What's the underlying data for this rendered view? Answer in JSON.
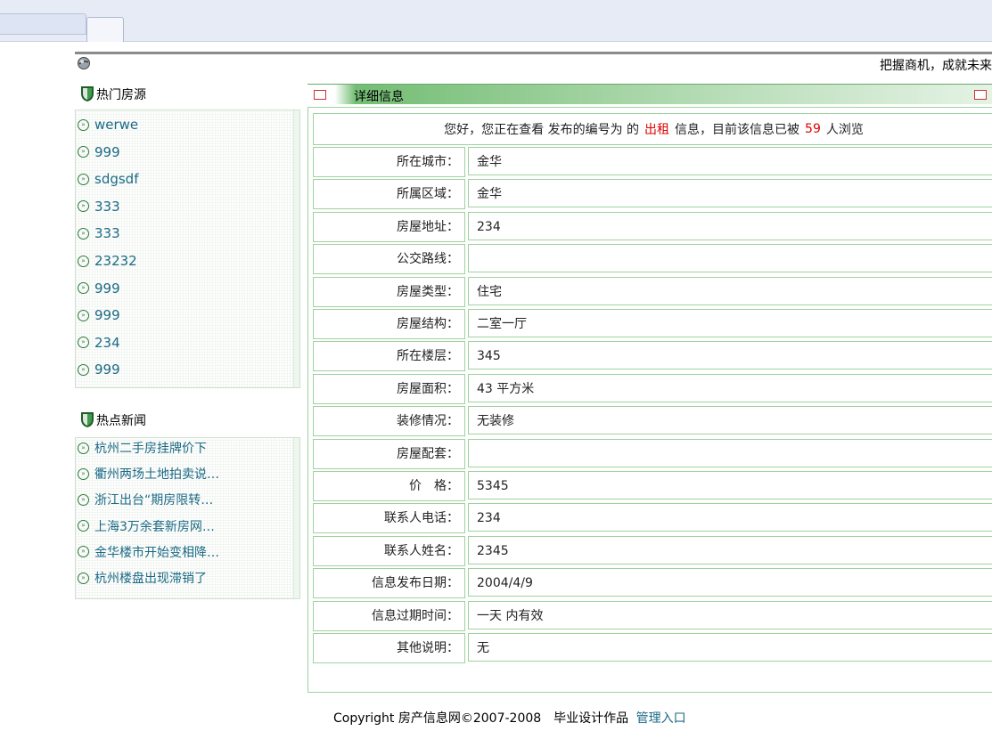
{
  "header": {
    "slogan": "把握商机，成就未来"
  },
  "hot_listings": {
    "title": "热门房源",
    "items": [
      "werwe",
      "999",
      "sdgsdf",
      "333",
      "333",
      "23232",
      "999",
      "999",
      "234",
      "999"
    ]
  },
  "hot_news": {
    "title": "热点新闻",
    "items": [
      "杭州二手房挂牌价下",
      "衢州两场土地拍卖说…",
      "浙江出台“期房限转…",
      "上海3万余套新房网…",
      "金华楼市开始变相降…",
      "杭州楼盘出现滞销了"
    ]
  },
  "detail": {
    "panel_title": "详细信息",
    "summary": {
      "prefix": "您好，您正在查看 发布的编号为 的",
      "type": "出租",
      "middle": "信息，目前该信息已被",
      "views": "59",
      "suffix": "人浏览"
    },
    "rows": [
      {
        "label": "所在城市：",
        "value": "金华"
      },
      {
        "label": "所属区域：",
        "value": "金华"
      },
      {
        "label": "房屋地址：",
        "value": "234"
      },
      {
        "label": "公交路线：",
        "value": ""
      },
      {
        "label": "房屋类型：",
        "value": "住宅"
      },
      {
        "label": "房屋结构：",
        "value": "二室一厅"
      },
      {
        "label": "所在楼层：",
        "value": "345"
      },
      {
        "label": "房屋面积：",
        "value": "43 平方米"
      },
      {
        "label": "装修情况：",
        "value": "无装修"
      },
      {
        "label": "房屋配套：",
        "value": ""
      },
      {
        "label": "价　格：",
        "value": "5345"
      },
      {
        "label": "联系人电话：",
        "value": "234"
      },
      {
        "label": "联系人姓名：",
        "value": "2345"
      },
      {
        "label": "信息发布日期：",
        "value": "2004/4/9"
      },
      {
        "label": "信息过期时间：",
        "value": "一天 内有效"
      },
      {
        "label": "其他说明：",
        "value": "无"
      }
    ]
  },
  "footer": {
    "copyright": "Copyright 房产信息网©2007-2008　毕业设计作品",
    "admin_link": "管理入口"
  },
  "colors": {
    "accent_green": "#74bd74",
    "link_teal": "#1b6a86",
    "highlight_red": "#e00000",
    "table_border": "#9fd29f"
  }
}
